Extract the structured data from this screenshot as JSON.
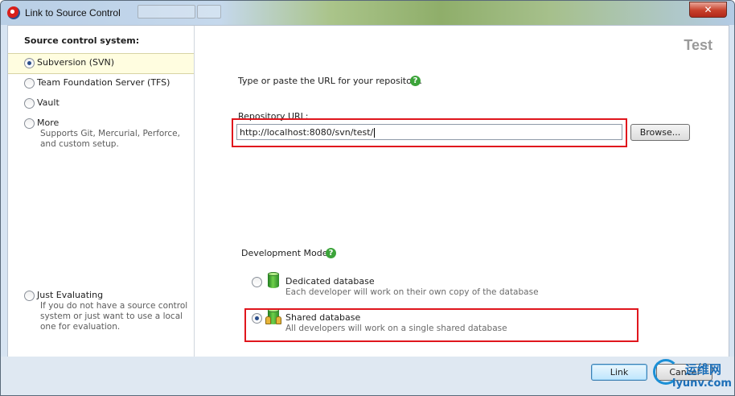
{
  "window": {
    "title": "Link to Source Control",
    "close_glyph": "✕"
  },
  "left_panel": {
    "heading": "Source control system:",
    "options": [
      {
        "label": "Subversion (SVN)",
        "selected": true
      },
      {
        "label": "Team Foundation Server (TFS)",
        "selected": false
      },
      {
        "label": "Vault",
        "selected": false
      },
      {
        "label": "More",
        "description": "Supports Git, Mercurial, Perforce, and custom setup.",
        "selected": false
      },
      {
        "label": "Just Evaluating",
        "description": "If you do not have a source control system or just want to use a local one for evaluation.",
        "selected": false
      }
    ]
  },
  "main": {
    "database_name": "Test",
    "intro_text": "Type or paste the URL for your repository.",
    "help_glyph": "?",
    "repository_url_label": "Repository URL:",
    "repository_url_value": "http://localhost:8080/svn/test/",
    "browse_label": "Browse...",
    "development_model_label": "Development Model:",
    "models": [
      {
        "label": "Dedicated database",
        "description": "Each developer will work on their own copy of the database",
        "selected": false,
        "icon": "database-icon"
      },
      {
        "label": "Shared database",
        "description": "All developers will work on a single shared database",
        "selected": true,
        "icon": "shared-database-icon"
      }
    ]
  },
  "footer": {
    "link_label": "Link",
    "cancel_label": "Cancel"
  },
  "watermark": {
    "chinese": "运维网",
    "domain": "iyunv.com"
  },
  "colors": {
    "highlight_box": "#e0161d",
    "help_icon": "#3ca43a",
    "selected_option_bg": "#fffde0"
  }
}
